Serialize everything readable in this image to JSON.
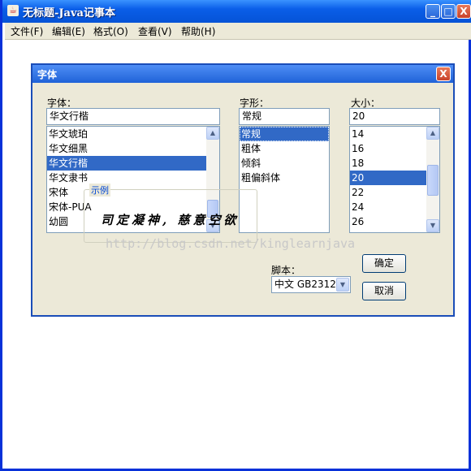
{
  "window": {
    "title": "无标题-Java记事本",
    "icon": "java-cup-icon",
    "controls": {
      "minimize": "_",
      "maximize": "□",
      "close": "X"
    }
  },
  "menu": [
    "文件(F)",
    "编辑(E)",
    "格式(O)",
    "查看(V)",
    "帮助(H)"
  ],
  "dialog": {
    "title": "字体",
    "close": "X",
    "font": {
      "label": "字体：",
      "value": "华文行楷",
      "items": [
        "华文琥珀",
        "华文细黑",
        "华文行楷",
        "华文隶书",
        "宋体",
        "宋体-PUA",
        "幼圆"
      ],
      "selected_index": 2
    },
    "style": {
      "label": "字形：",
      "value": "常规",
      "items": [
        "常规",
        "粗体",
        "倾斜",
        "粗偏斜体"
      ],
      "selected_index": 0
    },
    "size": {
      "label": "大小：",
      "value": "20",
      "items": [
        "14",
        "16",
        "18",
        "20",
        "22",
        "24",
        "26"
      ],
      "selected_index": 3
    },
    "sample": {
      "legend": "示例",
      "text": "司定凝神, 慈意空欲"
    },
    "script": {
      "label": "脚本：",
      "value": "中文 GB2312"
    },
    "ok_label": "确定",
    "cancel_label": "取消"
  },
  "watermark": "http://blog.csdn.net/kinglearnjava",
  "colors": {
    "selection": "#3169c6",
    "titlebar": "#0a5ee8",
    "dialog_bg": "#ece9d8"
  }
}
